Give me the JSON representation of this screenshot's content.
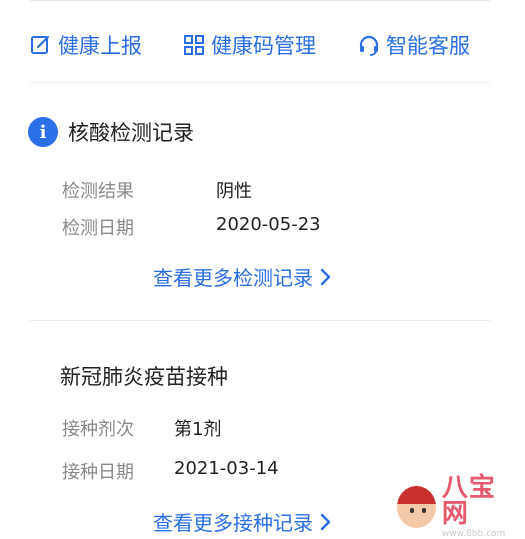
{
  "quick_nav": {
    "items": [
      {
        "label": "健康上报",
        "icon": "edit-icon"
      },
      {
        "label": "健康码管理",
        "icon": "grid-icon"
      },
      {
        "label": "智能客服",
        "icon": "headset-icon"
      }
    ]
  },
  "nucleic_test": {
    "title": "核酸检测记录",
    "rows": [
      {
        "label": "检测结果",
        "value": "阴性"
      },
      {
        "label": "检测日期",
        "value": "2020-05-23"
      }
    ],
    "more_label": "查看更多检测记录"
  },
  "vaccine": {
    "title": "新冠肺炎疫苗接种",
    "rows": [
      {
        "label": "接种剂次",
        "value": "第1剂"
      },
      {
        "label": "接种日期",
        "value": "2021-03-14"
      }
    ],
    "more_label": "查看更多接种记录"
  },
  "watermark": {
    "title": "八宝网",
    "url": "www.8bb.com"
  },
  "colors": {
    "accent": "#2a6fe6",
    "label_gray": "#8a8a8a"
  }
}
